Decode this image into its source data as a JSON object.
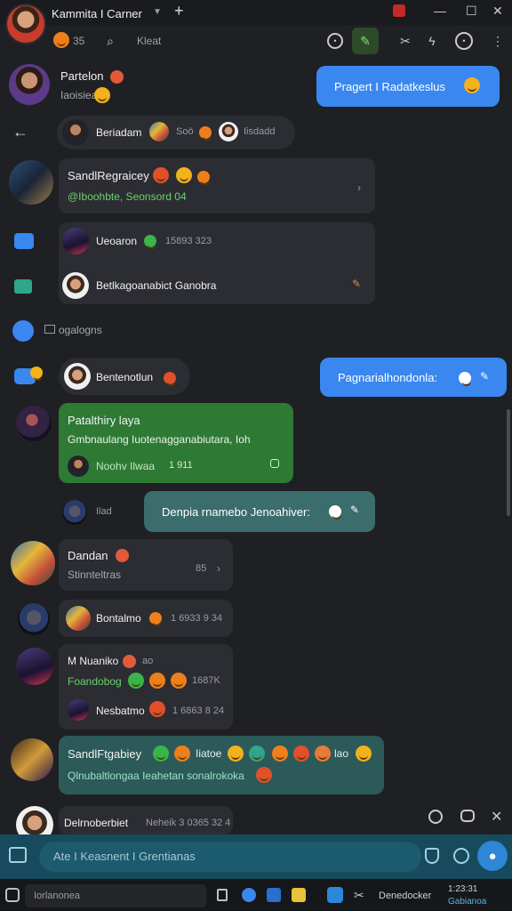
{
  "window": {
    "title": "Kammita I Carner",
    "new_tab": "+",
    "minimize": "—",
    "maximize": "☐",
    "close": "✕",
    "restore": "⧉"
  },
  "toolbar": {
    "badge_count": "35",
    "search_placeholder": "Kleat"
  },
  "messages": {
    "m1": {
      "name": "Partelon",
      "sub": "Iaoisiea"
    },
    "m1_reply": {
      "text": "Pragert I Radatkeslus"
    },
    "back_row": {
      "name": "Beriadam",
      "mid": "Soö",
      "right": "Iisdadd"
    },
    "group1": {
      "name": "SandlRegraicey",
      "sub": "@Iboohbte, Seonsord 04"
    },
    "media1": {
      "name": "Ueoaron",
      "meta": "15893 323",
      "name2": "Betlkagoanabict Ganobra"
    },
    "section": {
      "label": "ogalogns"
    },
    "pill": {
      "name": "Bentenotlun"
    },
    "reply2": {
      "text": "Pagnarialhondonla:"
    },
    "green": {
      "name": "Patalthiry laya",
      "body": "Gmbnaulang Iuotenagganabiutara, Ioh",
      "sub": "Noohv Ilwaa",
      "meta": "1 911"
    },
    "teal1": {
      "side": "Ilad",
      "text": "Denpia rnamebo Jenoahiver:"
    },
    "row_dan": {
      "name": "Dandan",
      "sub": "Stinnteltras",
      "count": "85"
    },
    "row_bort": {
      "name": "Bontalmo",
      "meta": "1 6933 9 34"
    },
    "card": {
      "name": "M Nuaniko",
      "tag": "ao",
      "gtext": "Foandobog",
      "meta1": "1687K",
      "name2": "Nesbatmo",
      "meta2": "1 6863 8 24"
    },
    "teal2": {
      "name": "SandlFtgabiey",
      "tag": "Iiatoe",
      "tag2": "lao",
      "body": "Qlnubaltlongaa Ieahetan sonalrokoka"
    },
    "last": {
      "name": "Delrnoberbiet",
      "meta": "Neheik 3 0365 32 4"
    }
  },
  "compose": {
    "placeholder": "Ate I Keasnent I Grentianas"
  },
  "taskbar": {
    "search": "Iorlanonea",
    "app_label": "Denedocker",
    "time": "1:23:31",
    "date": "Gabianoa"
  },
  "colors": {
    "accent": "#3a87ef",
    "green_bubble": "#2e7a34",
    "teal_bubble": "#3a6d6b",
    "compose": "#174a5c"
  }
}
